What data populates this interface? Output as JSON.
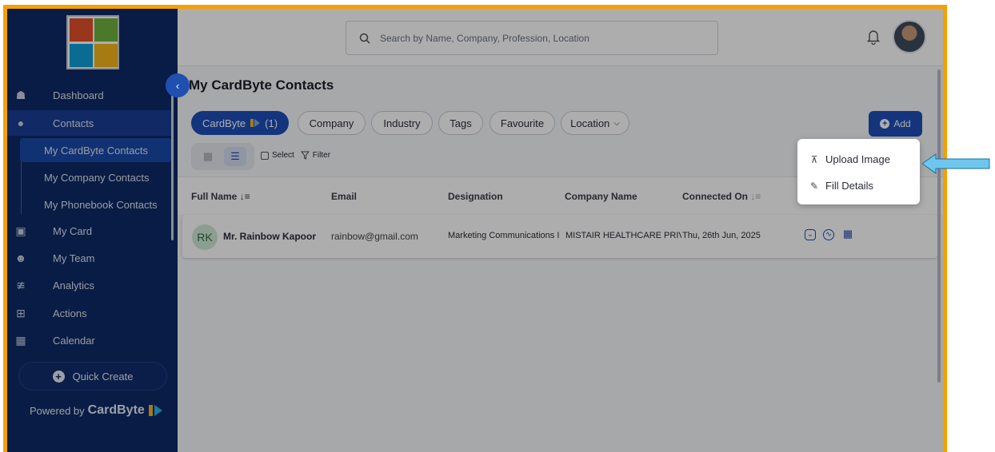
{
  "sidebar": {
    "nav": [
      {
        "label": "Dashboard",
        "icon": "home-icon"
      },
      {
        "label": "Contacts",
        "icon": "person-icon"
      },
      {
        "label": "My Card",
        "icon": "card-icon"
      },
      {
        "label": "My Team",
        "icon": "team-icon"
      },
      {
        "label": "Analytics",
        "icon": "analytics-icon"
      },
      {
        "label": "Actions",
        "icon": "actions-icon"
      },
      {
        "label": "Calendar",
        "icon": "calendar-icon"
      }
    ],
    "sub_items": [
      {
        "label": "My CardByte Contacts"
      },
      {
        "label": "My Company Contacts"
      },
      {
        "label": "My Phonebook Contacts"
      }
    ],
    "quick_create": "Quick Create",
    "powered_prefix": "Powered by",
    "powered_brand": "CardByte"
  },
  "header": {
    "search_placeholder": "Search by Name, Company, Profession, Location"
  },
  "page": {
    "title": "My CardByte Contacts",
    "filters": [
      "CardByte",
      "(1)",
      "Company",
      "Industry",
      "Tags",
      "Favourite",
      "Location"
    ],
    "add_label": "Add",
    "select_label": "Select",
    "filter_label": "Filter"
  },
  "table": {
    "headers": [
      "Full Name",
      "Email",
      "Designation",
      "Company Name",
      "Connected On"
    ],
    "rows": [
      {
        "initials": "RK",
        "name": "Mr. Rainbow Kapoor",
        "email": "rainbow@gmail.com",
        "designation": "Marketing Communications I",
        "company": "MISTAIR HEALTHCARE PRIV",
        "connected_on": "Thu, 26th Jun, 2025"
      }
    ]
  },
  "add_menu": {
    "items": [
      "Upload Image",
      "Fill Details"
    ]
  },
  "colors": {
    "sidebar": "#0e2a66",
    "primary": "#1e4fb8",
    "frame": "#f5a000",
    "pointer": "#6ec6ee"
  }
}
